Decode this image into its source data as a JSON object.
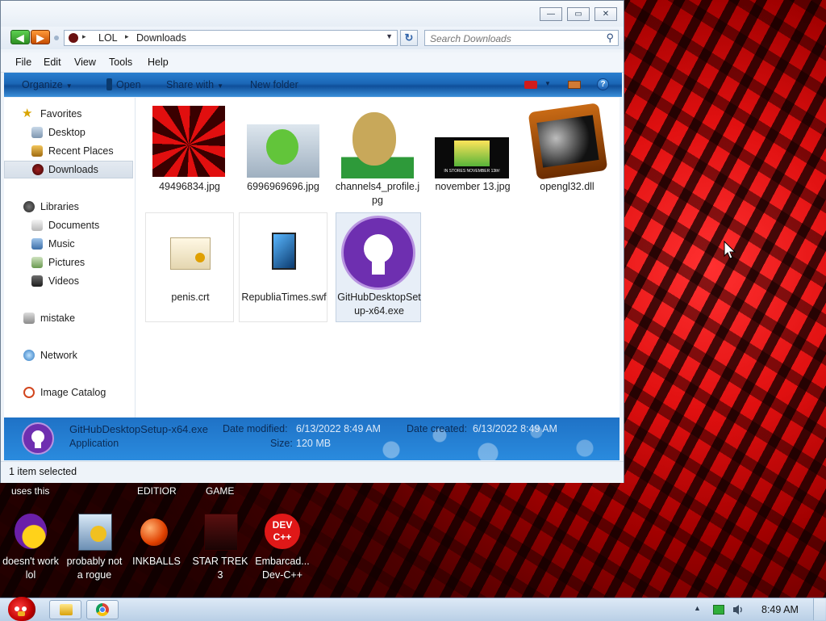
{
  "window": {
    "caption_buttons": {
      "minimize": "—",
      "maximize": "▭",
      "close": "✕"
    },
    "nav": {
      "back_icon": "back-arrow-icon",
      "forward_icon": "forward-arrow-icon"
    },
    "address": {
      "segments": [
        "LOL",
        "Downloads"
      ],
      "chevron": "▸"
    },
    "refresh_icon": "↻",
    "search": {
      "placeholder": "Search Downloads",
      "icon": "⚲"
    },
    "menu": [
      "File",
      "Edit",
      "View",
      "Tools",
      "Help"
    ],
    "toolbar": {
      "organize": "Organize",
      "open": "Open",
      "share_with": "Share with",
      "new_folder": "New folder",
      "help": "?"
    },
    "sidebar": {
      "favorites": "Favorites",
      "desktop": "Desktop",
      "recent_places": "Recent Places",
      "downloads": "Downloads",
      "libraries": "Libraries",
      "documents": "Documents",
      "music": "Music",
      "pictures": "Pictures",
      "videos": "Videos",
      "mistake": "mistake",
      "network": "Network",
      "image_catalog": "Image Catalog"
    },
    "files": [
      {
        "name": "49496834.jpg"
      },
      {
        "name": "6996969696.jpg"
      },
      {
        "name": "channels4_profile.jpg"
      },
      {
        "name": "november 13.jpg",
        "thumb_caption": "IN STORES NOVEMBER 13th!"
      },
      {
        "name": "opengl32.dll"
      },
      {
        "name": "penis.crt"
      },
      {
        "name": "RepubliaTimes.swf"
      },
      {
        "name": "GitHubDesktopSetup-x64.exe",
        "selected": true
      }
    ],
    "details": {
      "name": "GitHubDesktopSetup-x64.exe",
      "type": "Application",
      "modified_label": "Date modified:",
      "modified_value": "6/13/2022 8:49 AM",
      "created_label": "Date created:",
      "created_value": "6/13/2022 8:49 AM",
      "size_label": "Size:",
      "size_value": "120 MB"
    },
    "status": "1 item selected"
  },
  "desktop": {
    "top_labels": [
      "uses this",
      "EDITIOR",
      "GAME"
    ],
    "icons": [
      {
        "label": "doesn't work lol"
      },
      {
        "label": "probably not a rogue"
      },
      {
        "label": "INKBALLS"
      },
      {
        "label": "STAR TREK 3"
      },
      {
        "label": "Embarcad... Dev-C++",
        "badge": "DEV C++"
      }
    ]
  },
  "taskbar": {
    "clock": "8:49 AM",
    "tray_arrow": "▲"
  },
  "colors": {
    "toolbar_blue": "#1b67b6",
    "github_purple": "#6e2fb0",
    "accent_red": "#e01010"
  }
}
